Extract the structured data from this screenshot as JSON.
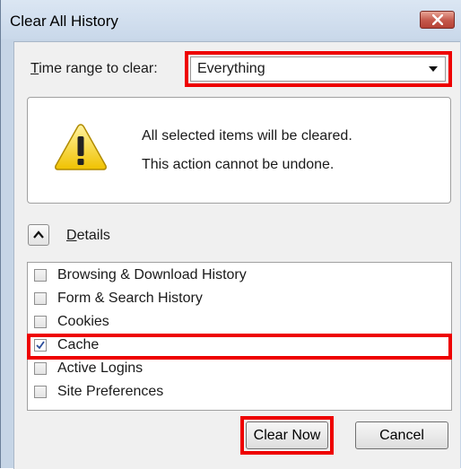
{
  "window": {
    "title": "Clear All History",
    "close_icon": "close-icon"
  },
  "time_range": {
    "label_prefix": "",
    "label_access_key": "T",
    "label_rest": "ime range to clear:",
    "selected": "Everything",
    "dropdown_icon": "chevron-down-icon"
  },
  "warning": {
    "icon": "warning-icon",
    "line1": "All selected items will be cleared.",
    "line2": "This action cannot be undone."
  },
  "details": {
    "toggle_icon": "chevron-up-icon",
    "label_access_key": "D",
    "label_rest": "etails",
    "expanded": true
  },
  "items": [
    {
      "label": "Browsing & Download History",
      "checked": false
    },
    {
      "label": "Form & Search History",
      "checked": false
    },
    {
      "label": "Cookies",
      "checked": false
    },
    {
      "label": "Cache",
      "checked": true
    },
    {
      "label": "Active Logins",
      "checked": false
    },
    {
      "label": "Site Preferences",
      "checked": false
    }
  ],
  "buttons": {
    "clear_now": "Clear Now",
    "cancel": "Cancel"
  },
  "colors": {
    "highlight": "#ee0000",
    "title_bar": "#c9d8ea",
    "close_button": "#c4574a",
    "warning_yellow": "#f5d21e"
  }
}
